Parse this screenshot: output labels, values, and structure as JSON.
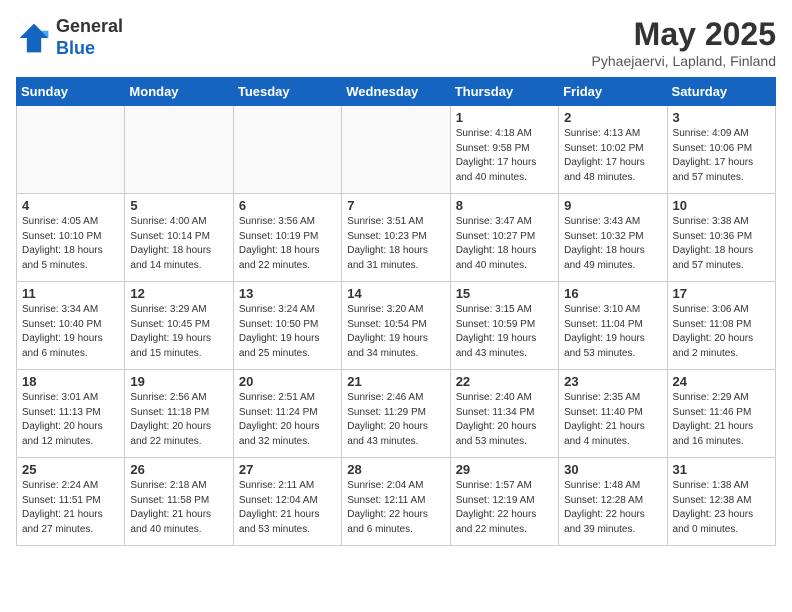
{
  "header": {
    "logo_general": "General",
    "logo_blue": "Blue",
    "month_year": "May 2025",
    "location": "Pyhaejaervi, Lapland, Finland"
  },
  "days_of_week": [
    "Sunday",
    "Monday",
    "Tuesday",
    "Wednesday",
    "Thursday",
    "Friday",
    "Saturday"
  ],
  "weeks": [
    [
      {
        "day": "",
        "info": ""
      },
      {
        "day": "",
        "info": ""
      },
      {
        "day": "",
        "info": ""
      },
      {
        "day": "",
        "info": ""
      },
      {
        "day": "1",
        "info": "Sunrise: 4:18 AM\nSunset: 9:58 PM\nDaylight: 17 hours\nand 40 minutes."
      },
      {
        "day": "2",
        "info": "Sunrise: 4:13 AM\nSunset: 10:02 PM\nDaylight: 17 hours\nand 48 minutes."
      },
      {
        "day": "3",
        "info": "Sunrise: 4:09 AM\nSunset: 10:06 PM\nDaylight: 17 hours\nand 57 minutes."
      }
    ],
    [
      {
        "day": "4",
        "info": "Sunrise: 4:05 AM\nSunset: 10:10 PM\nDaylight: 18 hours\nand 5 minutes."
      },
      {
        "day": "5",
        "info": "Sunrise: 4:00 AM\nSunset: 10:14 PM\nDaylight: 18 hours\nand 14 minutes."
      },
      {
        "day": "6",
        "info": "Sunrise: 3:56 AM\nSunset: 10:19 PM\nDaylight: 18 hours\nand 22 minutes."
      },
      {
        "day": "7",
        "info": "Sunrise: 3:51 AM\nSunset: 10:23 PM\nDaylight: 18 hours\nand 31 minutes."
      },
      {
        "day": "8",
        "info": "Sunrise: 3:47 AM\nSunset: 10:27 PM\nDaylight: 18 hours\nand 40 minutes."
      },
      {
        "day": "9",
        "info": "Sunrise: 3:43 AM\nSunset: 10:32 PM\nDaylight: 18 hours\nand 49 minutes."
      },
      {
        "day": "10",
        "info": "Sunrise: 3:38 AM\nSunset: 10:36 PM\nDaylight: 18 hours\nand 57 minutes."
      }
    ],
    [
      {
        "day": "11",
        "info": "Sunrise: 3:34 AM\nSunset: 10:40 PM\nDaylight: 19 hours\nand 6 minutes."
      },
      {
        "day": "12",
        "info": "Sunrise: 3:29 AM\nSunset: 10:45 PM\nDaylight: 19 hours\nand 15 minutes."
      },
      {
        "day": "13",
        "info": "Sunrise: 3:24 AM\nSunset: 10:50 PM\nDaylight: 19 hours\nand 25 minutes."
      },
      {
        "day": "14",
        "info": "Sunrise: 3:20 AM\nSunset: 10:54 PM\nDaylight: 19 hours\nand 34 minutes."
      },
      {
        "day": "15",
        "info": "Sunrise: 3:15 AM\nSunset: 10:59 PM\nDaylight: 19 hours\nand 43 minutes."
      },
      {
        "day": "16",
        "info": "Sunrise: 3:10 AM\nSunset: 11:04 PM\nDaylight: 19 hours\nand 53 minutes."
      },
      {
        "day": "17",
        "info": "Sunrise: 3:06 AM\nSunset: 11:08 PM\nDaylight: 20 hours\nand 2 minutes."
      }
    ],
    [
      {
        "day": "18",
        "info": "Sunrise: 3:01 AM\nSunset: 11:13 PM\nDaylight: 20 hours\nand 12 minutes."
      },
      {
        "day": "19",
        "info": "Sunrise: 2:56 AM\nSunset: 11:18 PM\nDaylight: 20 hours\nand 22 minutes."
      },
      {
        "day": "20",
        "info": "Sunrise: 2:51 AM\nSunset: 11:24 PM\nDaylight: 20 hours\nand 32 minutes."
      },
      {
        "day": "21",
        "info": "Sunrise: 2:46 AM\nSunset: 11:29 PM\nDaylight: 20 hours\nand 43 minutes."
      },
      {
        "day": "22",
        "info": "Sunrise: 2:40 AM\nSunset: 11:34 PM\nDaylight: 20 hours\nand 53 minutes."
      },
      {
        "day": "23",
        "info": "Sunrise: 2:35 AM\nSunset: 11:40 PM\nDaylight: 21 hours\nand 4 minutes."
      },
      {
        "day": "24",
        "info": "Sunrise: 2:29 AM\nSunset: 11:46 PM\nDaylight: 21 hours\nand 16 minutes."
      }
    ],
    [
      {
        "day": "25",
        "info": "Sunrise: 2:24 AM\nSunset: 11:51 PM\nDaylight: 21 hours\nand 27 minutes."
      },
      {
        "day": "26",
        "info": "Sunrise: 2:18 AM\nSunset: 11:58 PM\nDaylight: 21 hours\nand 40 minutes."
      },
      {
        "day": "27",
        "info": "Sunrise: 2:11 AM\nSunset: 12:04 AM\nDaylight: 21 hours\nand 53 minutes."
      },
      {
        "day": "28",
        "info": "Sunrise: 2:04 AM\nSunset: 12:11 AM\nDaylight: 22 hours\nand 6 minutes."
      },
      {
        "day": "29",
        "info": "Sunrise: 1:57 AM\nSunset: 12:19 AM\nDaylight: 22 hours\nand 22 minutes."
      },
      {
        "day": "30",
        "info": "Sunrise: 1:48 AM\nSunset: 12:28 AM\nDaylight: 22 hours\nand 39 minutes."
      },
      {
        "day": "31",
        "info": "Sunrise: 1:38 AM\nSunset: 12:38 AM\nDaylight: 23 hours\nand 0 minutes."
      }
    ]
  ]
}
